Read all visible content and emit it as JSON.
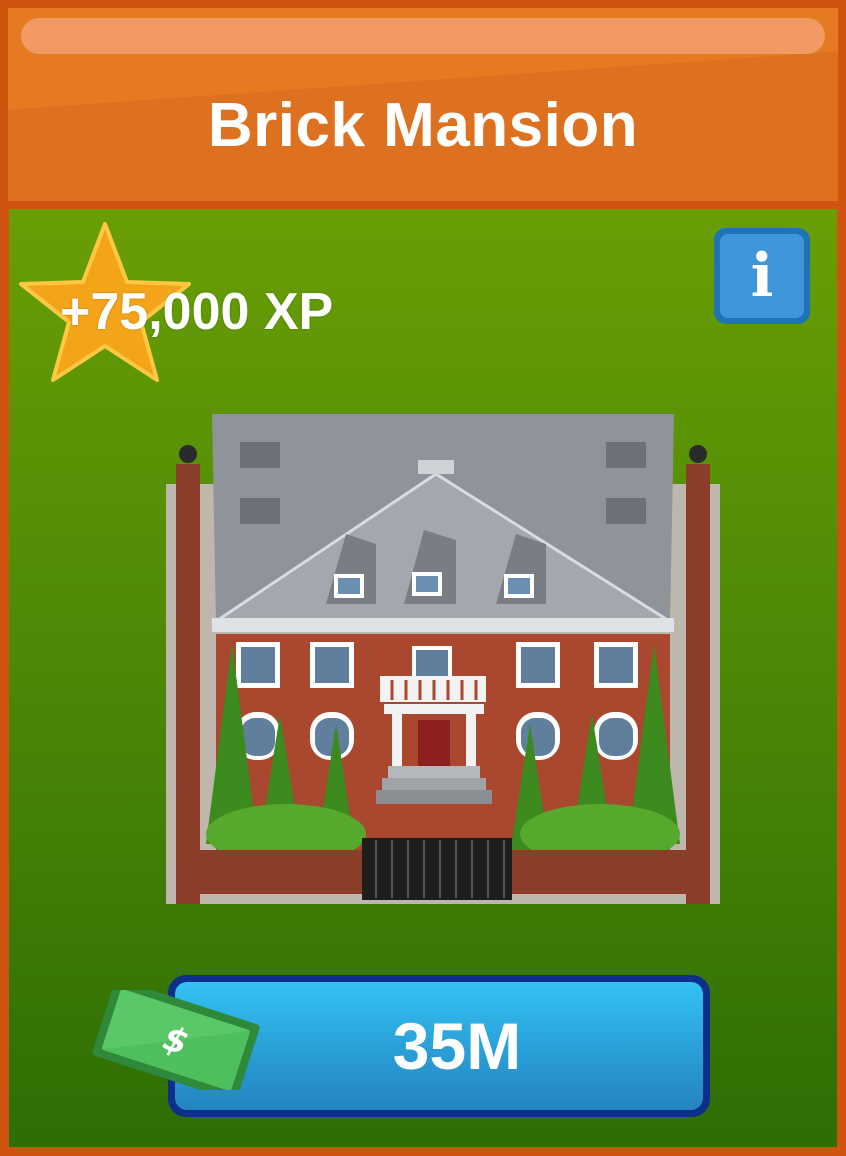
{
  "card": {
    "title": "Brick Mansion",
    "xp_label": "+75,000 XP",
    "info_icon": "info-icon",
    "price_label": "35M",
    "currency_symbol": "$",
    "colors": {
      "header": "#e57a22",
      "border": "#d0540f",
      "body_top": "#6a9e06",
      "body_bottom": "#2d6e05",
      "star": "#f4a419",
      "info_button": "#3f96d8",
      "buy_button": "#2a9ed6",
      "cash": "#3aa54a"
    }
  }
}
